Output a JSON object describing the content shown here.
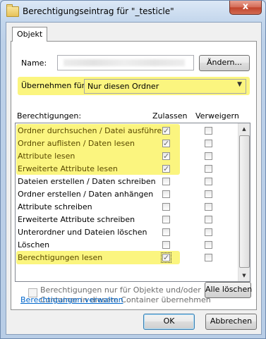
{
  "window": {
    "title": "Berechtigungseintrag für \"_testicle\"",
    "close": "x"
  },
  "tab": {
    "label": "Objekt"
  },
  "name": {
    "label": "Name:",
    "change_button": "Ändern..."
  },
  "apply_to": {
    "label": "Übernehmen für:",
    "selected": "Nur diesen Ordner"
  },
  "permissions": {
    "header": "Berechtigungen:",
    "col_allow": "Zulassen",
    "col_deny": "Verweigern",
    "rows": [
      {
        "label": "Ordner durchsuchen / Datei ausführen",
        "allow": true,
        "deny": false,
        "highlighted": true
      },
      {
        "label": "Ordner auflisten / Daten lesen",
        "allow": true,
        "deny": false,
        "highlighted": true
      },
      {
        "label": "Attribute lesen",
        "allow": true,
        "deny": false,
        "highlighted": true
      },
      {
        "label": "Erweiterte Attribute lesen",
        "allow": true,
        "deny": false,
        "highlighted": true
      },
      {
        "label": "Dateien erstellen / Daten schreiben",
        "allow": false,
        "deny": false,
        "highlighted": false
      },
      {
        "label": "Ordner erstellen / Daten anhängen",
        "allow": false,
        "deny": false,
        "highlighted": false
      },
      {
        "label": "Attribute schreiben",
        "allow": false,
        "deny": false,
        "highlighted": false
      },
      {
        "label": "Erweiterte Attribute schreiben",
        "allow": false,
        "deny": false,
        "highlighted": false
      },
      {
        "label": "Unterordner und Dateien löschen",
        "allow": false,
        "deny": false,
        "highlighted": false
      },
      {
        "label": "Löschen",
        "allow": false,
        "deny": false,
        "highlighted": false
      },
      {
        "label": "Berechtigungen lesen",
        "allow": true,
        "deny": false,
        "highlighted": true
      }
    ]
  },
  "apply_inherit": {
    "line1": "Berechtigungen nur für Objekte und/oder",
    "line2": "Container in diesem Container übernehmen",
    "checked": false
  },
  "clear_all_button": "Alle löschen",
  "manage_link": "Berechtigungen verwalten",
  "ok_button": "OK",
  "cancel_button": "Abbrechen",
  "colors": {
    "highlight": "#fbf57f",
    "link": "#0066cc"
  }
}
